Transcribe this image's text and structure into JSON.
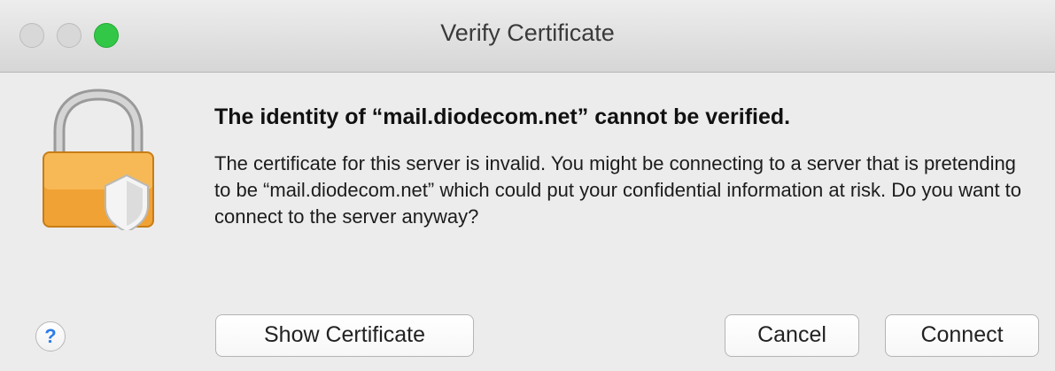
{
  "window": {
    "title": "Verify Certificate"
  },
  "alert": {
    "headline": "The identity of “mail.diodecom.net” cannot be verified.",
    "message": "The certificate for this server is invalid. You might be connecting to a server that is pretending to be “mail.diodecom.net” which could put your confidential information at risk. Do you want to connect to the server anyway?"
  },
  "buttons": {
    "help_label": "?",
    "show_certificate": "Show Certificate",
    "cancel": "Cancel",
    "connect": "Connect"
  },
  "icons": {
    "lock": "padlock-warning-icon",
    "help": "help-icon"
  },
  "colors": {
    "zoom_button": "#33c748",
    "lock_body": "#f0a235",
    "help_text": "#2c7ce9"
  }
}
